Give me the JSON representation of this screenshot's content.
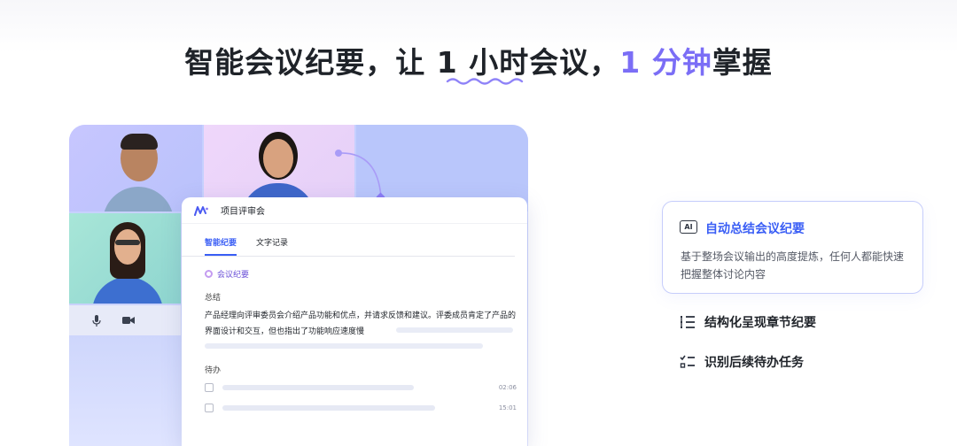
{
  "headline": {
    "part1": "智能会议纪要，让 ",
    "part2": "1 小时会议，",
    "accent": "1 分钟",
    "part3": "掌握"
  },
  "panel": {
    "title": "项目评审会",
    "tabs": [
      "智能纪要",
      "文字记录"
    ],
    "section_tag": "会议纪要",
    "summary_label": "总结",
    "summary_text": "产品经理向评审委员会介绍产品功能和优点，并请求反馈和建议。评委成员肯定了产品的界面设计和交互，但也指出了功能响应速度慢",
    "todo_label": "待办",
    "todos": [
      {
        "time": "02:06"
      },
      {
        "time": "15:01"
      }
    ]
  },
  "features": {
    "card": {
      "icon_text": "AI",
      "title": "自动总结会议纪要",
      "desc": "基于整场会议输出的高度提炼，任何人都能快速把握整体讨论内容"
    },
    "items": [
      {
        "icon": "structured-list-icon",
        "label": "结构化呈现章节纪要"
      },
      {
        "icon": "checklist-icon",
        "label": "识别后续待办任务"
      }
    ]
  },
  "colors": {
    "accent": "#7b6ef6",
    "primary_blue": "#3a5ef5",
    "text": "#1f2329"
  }
}
